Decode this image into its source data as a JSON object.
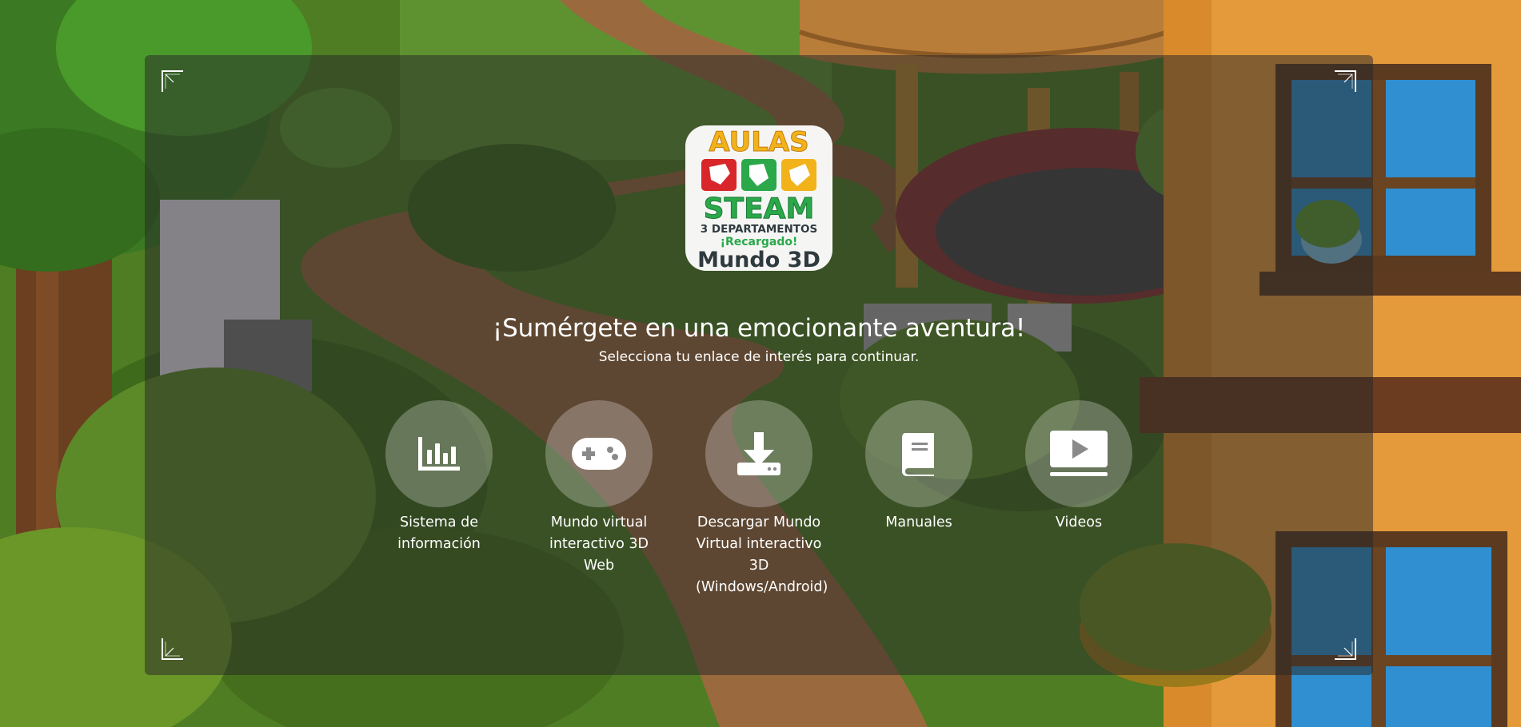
{
  "logo": {
    "line1": "AULAS",
    "line2": "STEAM",
    "line3": "3 DEPARTAMENTOS",
    "line4": "¡Recargado!",
    "line5": "Mundo 3D"
  },
  "heading": "¡Sumérgete en una emocionante aventura!",
  "subheading": "Selecciona tu enlace de interés para continuar.",
  "links": [
    {
      "label": "Sistema de información",
      "icon": "bar-chart-icon"
    },
    {
      "label": "Mundo virtual interactivo 3D Web",
      "icon": "gamepad-icon"
    },
    {
      "label": "Descargar Mundo Virtual interactivo 3D (Windows/Android)",
      "icon": "download-icon"
    },
    {
      "label": "Manuales",
      "icon": "book-icon"
    },
    {
      "label": "Videos",
      "icon": "video-play-icon"
    }
  ],
  "colors": {
    "panel_overlay": "rgba(40,40,40,0.52)",
    "circle_fill": "rgba(255,255,255,0.26)",
    "text": "#ffffff",
    "logo_yellow": "#f2b21a",
    "logo_green": "#2aa84a",
    "logo_red": "#d8262a",
    "logo_dark": "#2f3a3f"
  }
}
